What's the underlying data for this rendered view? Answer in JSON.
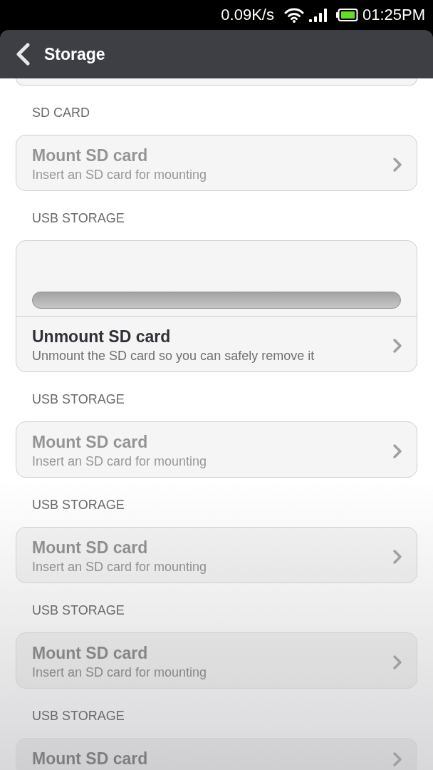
{
  "status_bar": {
    "network_speed": "0.09K/s",
    "time": "01:25PM"
  },
  "header": {
    "title": "Storage"
  },
  "sections": [
    {
      "title": "SD CARD",
      "kind": "plain",
      "items": [
        {
          "title": "Mount SD card",
          "subtitle": "Insert an SD card for mounting",
          "disabled": true
        }
      ]
    },
    {
      "title": "USB STORAGE",
      "kind": "usage",
      "items": [
        {
          "title": "Unmount SD card",
          "subtitle": "Unmount the SD card so you can safely remove it",
          "disabled": false
        }
      ]
    },
    {
      "title": "USB STORAGE",
      "kind": "plain",
      "items": [
        {
          "title": "Mount SD card",
          "subtitle": "Insert an SD card for mounting",
          "disabled": true
        }
      ]
    },
    {
      "title": "USB STORAGE",
      "kind": "plain",
      "items": [
        {
          "title": "Mount SD card",
          "subtitle": "Insert an SD card for mounting",
          "disabled": true
        }
      ]
    },
    {
      "title": "USB STORAGE",
      "kind": "plain",
      "items": [
        {
          "title": "Mount SD card",
          "subtitle": "Insert an SD card for mounting",
          "disabled": true
        }
      ]
    },
    {
      "title": "USB STORAGE",
      "kind": "plain",
      "items": [
        {
          "title": "Mount SD card",
          "disabled": true
        }
      ]
    }
  ]
}
